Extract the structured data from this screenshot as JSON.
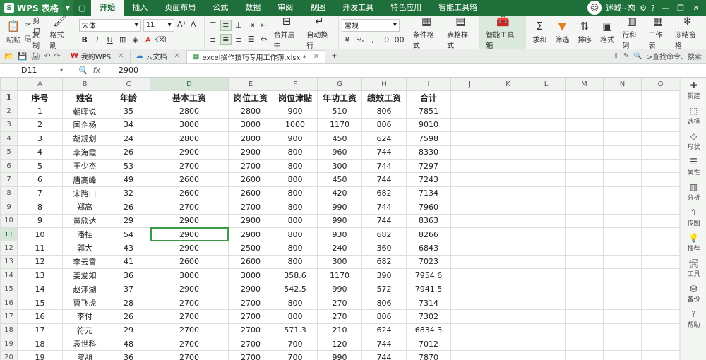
{
  "app": {
    "name": "WPS 表格"
  },
  "menu": {
    "tabs": [
      "开始",
      "插入",
      "页面布局",
      "公式",
      "数据",
      "审阅",
      "视图",
      "开发工具",
      "特色应用",
      "智能工具箱"
    ],
    "active_tab": 0,
    "user": "迷城~恋"
  },
  "ribbon": {
    "paste": "粘贴",
    "cut": "剪切",
    "copy": "复制",
    "format_painter": "格式刷",
    "font_name": "宋体",
    "font_size": "11",
    "merge_center": "合并居中",
    "wrap_text": "自动换行",
    "number_format": "常规",
    "conditional_format": "条件格式",
    "table_style": "表格样式",
    "smart_toolbox": "智能工具箱",
    "sum": "求和",
    "filter": "筛选",
    "sort": "排序",
    "format": "格式",
    "row_col": "行和列",
    "worksheet": "工作表",
    "freeze": "冻结窗格"
  },
  "tabstrip": {
    "tabs": [
      {
        "label": "我的WPS"
      },
      {
        "label": "云文档"
      },
      {
        "label": "excel操作技巧专用工作簿.xlsx *"
      }
    ],
    "search": ">查找命令、搜索"
  },
  "formula": {
    "cell": "D11",
    "value": "2900"
  },
  "grid": {
    "columns": [
      "A",
      "B",
      "C",
      "D",
      "E",
      "F",
      "G",
      "H",
      "I",
      "J",
      "K",
      "L",
      "M",
      "N",
      "O"
    ],
    "headers": [
      "序号",
      "姓名",
      "年龄",
      "基本工资",
      "岗位工资",
      "岗位津贴",
      "年功工资",
      "绩效工资",
      "合计"
    ],
    "rows": [
      [
        "1",
        "朝晖说",
        "35",
        "2800",
        "2800",
        "900",
        "510",
        "806",
        "7851"
      ],
      [
        "2",
        "国企杨",
        "34",
        "3000",
        "3000",
        "1000",
        "1170",
        "806",
        "9010"
      ],
      [
        "3",
        "胡规划",
        "24",
        "2800",
        "2800",
        "900",
        "450",
        "624",
        "7598"
      ],
      [
        "4",
        "李海霞",
        "26",
        "2900",
        "2900",
        "800",
        "960",
        "744",
        "8330"
      ],
      [
        "5",
        "王少杰",
        "53",
        "2700",
        "2700",
        "800",
        "300",
        "744",
        "7297"
      ],
      [
        "6",
        "唐高峰",
        "49",
        "2600",
        "2600",
        "800",
        "450",
        "744",
        "7243"
      ],
      [
        "7",
        "宋路口",
        "32",
        "2600",
        "2600",
        "800",
        "420",
        "682",
        "7134"
      ],
      [
        "8",
        "郑高",
        "26",
        "2700",
        "2700",
        "800",
        "990",
        "744",
        "7960"
      ],
      [
        "9",
        "黄欣达",
        "29",
        "2900",
        "2900",
        "800",
        "990",
        "744",
        "8363"
      ],
      [
        "10",
        "潘桂",
        "54",
        "2900",
        "2900",
        "800",
        "930",
        "682",
        "8266"
      ],
      [
        "11",
        "郭大",
        "43",
        "2900",
        "2500",
        "800",
        "240",
        "360",
        "6843"
      ],
      [
        "12",
        "李云霄",
        "41",
        "2600",
        "2600",
        "800",
        "300",
        "682",
        "7023"
      ],
      [
        "13",
        "姜爱如",
        "36",
        "3000",
        "3000",
        "358.6",
        "1170",
        "390",
        "7954.6"
      ],
      [
        "14",
        "赵泽湖",
        "37",
        "2900",
        "2900",
        "542.5",
        "990",
        "572",
        "7941.5"
      ],
      [
        "15",
        "曹飞虎",
        "28",
        "2700",
        "2700",
        "800",
        "270",
        "806",
        "7314"
      ],
      [
        "16",
        "李付",
        "26",
        "2700",
        "2700",
        "800",
        "270",
        "806",
        "7302"
      ],
      [
        "17",
        "符元",
        "29",
        "2700",
        "2700",
        "571.3",
        "210",
        "624",
        "6834.3"
      ],
      [
        "18",
        "袁世科",
        "48",
        "2700",
        "2700",
        "700",
        "120",
        "744",
        "7012"
      ],
      [
        "19",
        "罗胡",
        "36",
        "2700",
        "2700",
        "700",
        "990",
        "744",
        "7870"
      ]
    ]
  },
  "right_panel": [
    "新建",
    "选择",
    "形状",
    "属性",
    "分析",
    "传图",
    "推荐",
    "工具",
    "备份",
    "帮助"
  ]
}
